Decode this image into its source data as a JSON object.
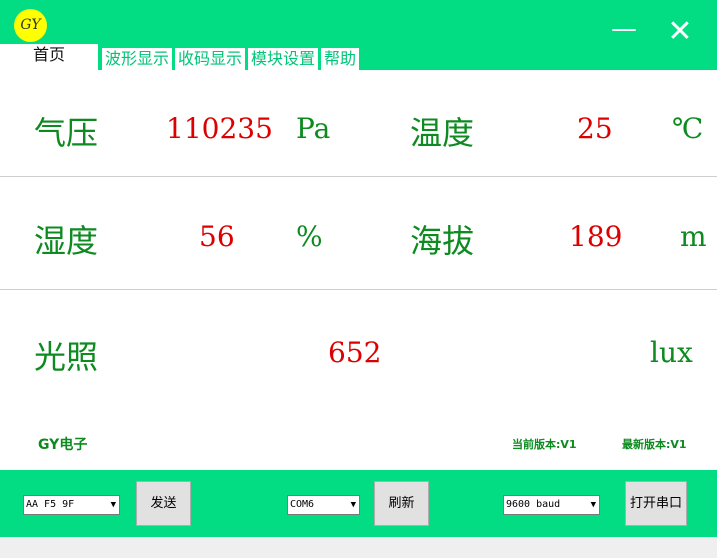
{
  "window": {
    "logo_text": "GY",
    "minimize_glyph": "—",
    "close_glyph": "✕"
  },
  "tabs": [
    "首页",
    "波形显示",
    "收码显示",
    "模块设置",
    "帮助"
  ],
  "readings": {
    "pressure": {
      "label": "气压",
      "value": "110235",
      "unit": "Pa"
    },
    "temperature": {
      "label": "温度",
      "value": "25",
      "unit": "℃"
    },
    "humidity": {
      "label": "湿度",
      "value": "56",
      "unit": "%"
    },
    "altitude": {
      "label": "海拔",
      "value": "189",
      "unit": "m"
    },
    "light": {
      "label": "光照",
      "value": "652",
      "unit": "lux"
    }
  },
  "footer": {
    "brand": "GY电子",
    "current_version": "当前版本:V1",
    "latest_version": "最新版本:V1"
  },
  "controls": {
    "command_select": "AA F5 9F",
    "send_label": "发送",
    "port_select": "COM6",
    "refresh_label": "刷新",
    "baud_select": "9600 baud",
    "open_port_label": "打开串口"
  },
  "colors": {
    "brand_green": "#02dd83",
    "label_green": "#0d8a20",
    "value_red": "#dd0000"
  }
}
